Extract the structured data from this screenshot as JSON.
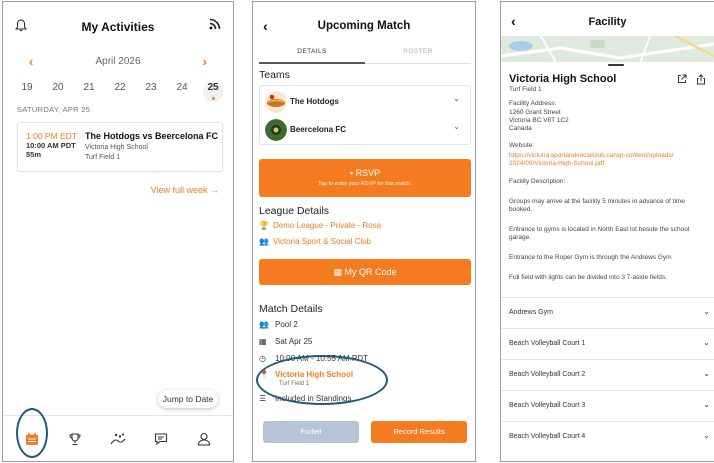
{
  "phone1": {
    "title": "My Activities",
    "month": "April 2026",
    "days": [
      "19",
      "20",
      "21",
      "22",
      "23",
      "24",
      "25"
    ],
    "selected_day_index": 6,
    "date_heading": "SATURDAY, APR 25",
    "event": {
      "time_local": "1:00 PM EDT",
      "time_other": "10:00 AM PDT",
      "duration": "55m",
      "title": "The Hotdogs vs Beercelona FC",
      "location": "Victoria High School",
      "field": "Turf Field 1"
    },
    "view_week": "View full week →",
    "jump_to_date": "Jump to Date",
    "tabs": [
      "calendar-icon",
      "trophy-icon",
      "sport-icon",
      "chat-icon",
      "profile-icon"
    ]
  },
  "phone2": {
    "title": "Upcoming Match",
    "tabs": [
      "DETAILS",
      "ROSTER"
    ],
    "teams_heading": "Teams",
    "teams": [
      {
        "name": "The Hotdogs",
        "color": "#c8742c"
      },
      {
        "name": "Beercelona FC",
        "color": "#3e6b2f"
      }
    ],
    "rsvp_label": "RSVP",
    "rsvp_sub": "Tap to enter your RSVP for this match.",
    "league_heading": "League Details",
    "league_name": "Demo League - Private - Rosa",
    "club_name": "Victoria Sport & Social Club",
    "qr_label": "My QR Code",
    "match_heading": "Match Details",
    "pool": "Pool 2",
    "date": "Sat Apr 25",
    "time": "10:00 AM - 10:55 AM PDT",
    "venue": "Victoria High School",
    "venue_field": "Turf Field 1",
    "standings": "Included in Standings",
    "forfeit_label": "Forfeit",
    "record_label": "Record Results"
  },
  "phone3": {
    "title": "Facility",
    "name": "Victoria High School",
    "field": "Turf Field 1",
    "address_label": "Facility Address:",
    "address": [
      "1260 Grant Street",
      "Victoria BC V8T 1C2",
      "Canada"
    ],
    "website_label": "Website:",
    "website": [
      "https://victoria.sportandsocialclub.ca/wp-content/uploads/",
      "2024/09/Victoria-High-School.pdf"
    ],
    "description_label": "Facility Description:",
    "description": [
      [
        "Groups may arrive at the facility 5 minutes in advance of time",
        "booked."
      ],
      [
        "Entrance to gyms is located in North East lot beside the school",
        "garage."
      ],
      [
        "Entrance to the Roper Gym is through the Andrews Gym"
      ],
      [
        "Full field with lights can be divided into 3 7-aside fields."
      ]
    ],
    "areas": [
      "Andrews Gym",
      "Beach Volleyball Court 1",
      "Beach Volleyball Court 2",
      "Beach Volleyball Court 3",
      "Beach Volleyball Court 4"
    ]
  },
  "colors": {
    "accent": "#f47b20",
    "annotation": "#1f5a7a",
    "disabled": "#b7c4d6"
  }
}
